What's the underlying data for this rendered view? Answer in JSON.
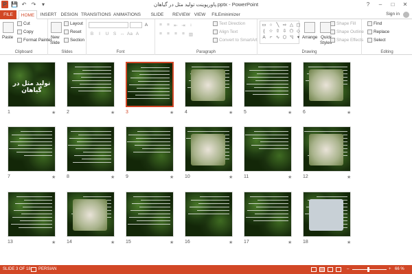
{
  "window": {
    "title": "پاورپوینت تولید مثل در گیاهان.pptx - PowerPoint",
    "help": "?",
    "minimize": "–",
    "maximize": "□",
    "close": "✕"
  },
  "qat": {
    "app_icon": "P",
    "save": "💾",
    "undo": "↶",
    "redo": "↷",
    "customize": "▾"
  },
  "tabs": [
    "FILE",
    "HOME",
    "INSERT",
    "DESIGN",
    "TRANSITIONS",
    "ANIMATIONS",
    "SLIDE SHOW",
    "REVIEW",
    "VIEW",
    "FILEminimizer"
  ],
  "active_tab": "HOME",
  "account": {
    "signin": "Sign in"
  },
  "ribbon": {
    "clipboard": {
      "label": "Clipboard",
      "paste": "Paste",
      "cut": "Cut",
      "copy": "Copy",
      "format_painter": "Format Painter"
    },
    "slides": {
      "label": "Slides",
      "new_slide": "New",
      "new_slide2": "Slide",
      "layout": "Layout",
      "reset": "Reset",
      "section": "Section"
    },
    "font": {
      "label": "Font"
    },
    "paragraph": {
      "label": "Paragraph",
      "text_direction": "Text Direction",
      "align_text": "Align Text",
      "convert_smartart": "Convert to SmartArt"
    },
    "drawing": {
      "label": "Drawing",
      "arrange": "Arrange",
      "quick_styles": "Quick",
      "quick_styles2": "Styles",
      "shape_fill": "Shape Fill",
      "shape_outline": "Shape Outline",
      "shape_effects": "Shape Effects"
    },
    "editing": {
      "label": "Editing",
      "find": "Find",
      "replace": "Replace",
      "select": "Select"
    }
  },
  "slides": [
    {
      "number": "1",
      "title": "تولید مثل در گیاهان"
    },
    {
      "number": "2"
    },
    {
      "number": "3"
    },
    {
      "number": "4"
    },
    {
      "number": "5"
    },
    {
      "number": "6"
    },
    {
      "number": "7"
    },
    {
      "number": "8"
    },
    {
      "number": "9"
    },
    {
      "number": "10"
    },
    {
      "number": "11"
    },
    {
      "number": "12"
    },
    {
      "number": "13"
    },
    {
      "number": "14"
    },
    {
      "number": "15"
    },
    {
      "number": "16"
    },
    {
      "number": "17"
    },
    {
      "number": "18"
    }
  ],
  "selected_slide": "3",
  "transition_marker": "★",
  "status": {
    "slide_info": "SLIDE 3 OF 18",
    "language": "PERSIAN",
    "zoom": "66 %",
    "zoom_minus": "–",
    "zoom_plus": "+"
  }
}
